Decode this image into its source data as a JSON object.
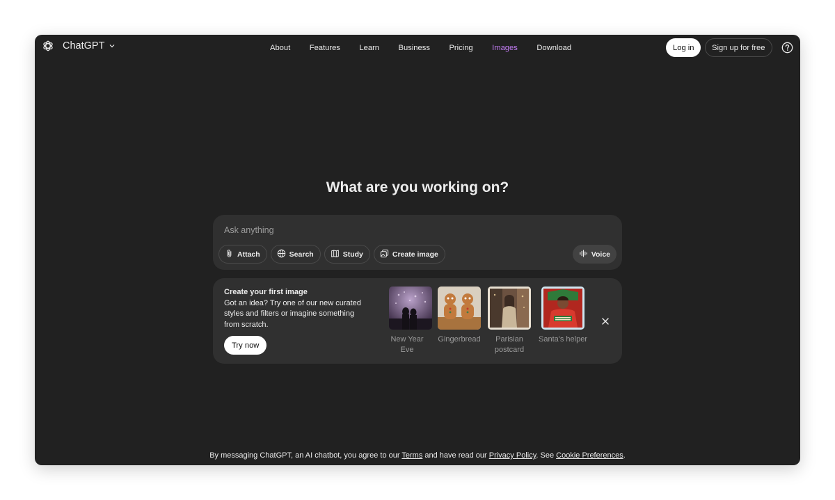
{
  "brand": {
    "name": "ChatGPT"
  },
  "nav": [
    {
      "label": "About",
      "active": false
    },
    {
      "label": "Features",
      "active": false
    },
    {
      "label": "Learn",
      "active": false
    },
    {
      "label": "Business",
      "active": false
    },
    {
      "label": "Pricing",
      "active": false
    },
    {
      "label": "Images",
      "active": true
    },
    {
      "label": "Download",
      "active": false
    }
  ],
  "auth": {
    "login": "Log in",
    "signup": "Sign up for free"
  },
  "main": {
    "headline": "What are you working on?"
  },
  "composer": {
    "placeholder": "Ask anything",
    "tools": {
      "attach": "Attach",
      "search": "Search",
      "study": "Study",
      "create_image": "Create image"
    },
    "voice": "Voice"
  },
  "promo": {
    "title": "Create your first image",
    "body": "Got an idea? Try one of our new curated styles and filters or imagine something from scratch.",
    "cta": "Try now",
    "styles": [
      {
        "label": "New Year Eve",
        "icon": "fireworks-couple-thumbnail"
      },
      {
        "label": "Gingerbread",
        "icon": "gingerbread-thumbnail"
      },
      {
        "label": "Parisian postcard",
        "icon": "parisian-postcard-thumbnail"
      },
      {
        "label": "Santa's helper",
        "icon": "santas-helper-thumbnail"
      }
    ]
  },
  "footer": {
    "prefix": "By messaging ChatGPT, an AI chatbot, you agree to our ",
    "terms": "Terms",
    "middle": " and have read our ",
    "privacy": "Privacy Policy",
    "see": ". See ",
    "cookies": "Cookie Preferences",
    "end": "."
  },
  "colors": {
    "background": "#212121",
    "surface": "#303030",
    "accent": "#c17cf2",
    "text": "#ececec",
    "muted": "#9b9b9b"
  }
}
